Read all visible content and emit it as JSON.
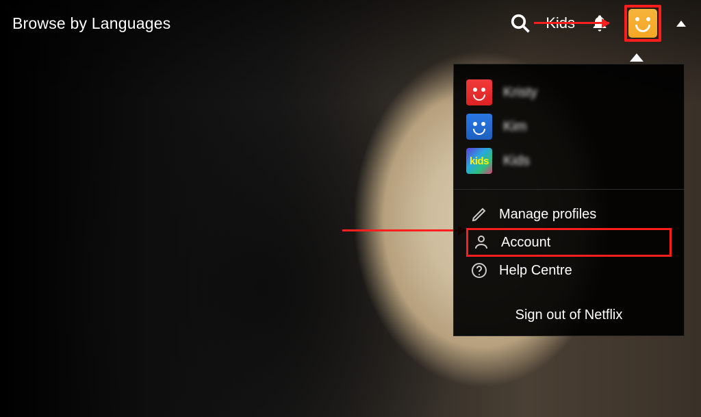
{
  "nav": {
    "browse_label": "Browse by Languages",
    "kids_label": "Kids"
  },
  "profiles": [
    {
      "name": "Kristy",
      "style": "red"
    },
    {
      "name": "Kim",
      "style": "blue"
    },
    {
      "name": "Kids",
      "style": "kids",
      "badge": "kids"
    }
  ],
  "menu": {
    "manage_profiles": "Manage profiles",
    "account": "Account",
    "help_centre": "Help Centre",
    "sign_out": "Sign out of Netflix"
  }
}
